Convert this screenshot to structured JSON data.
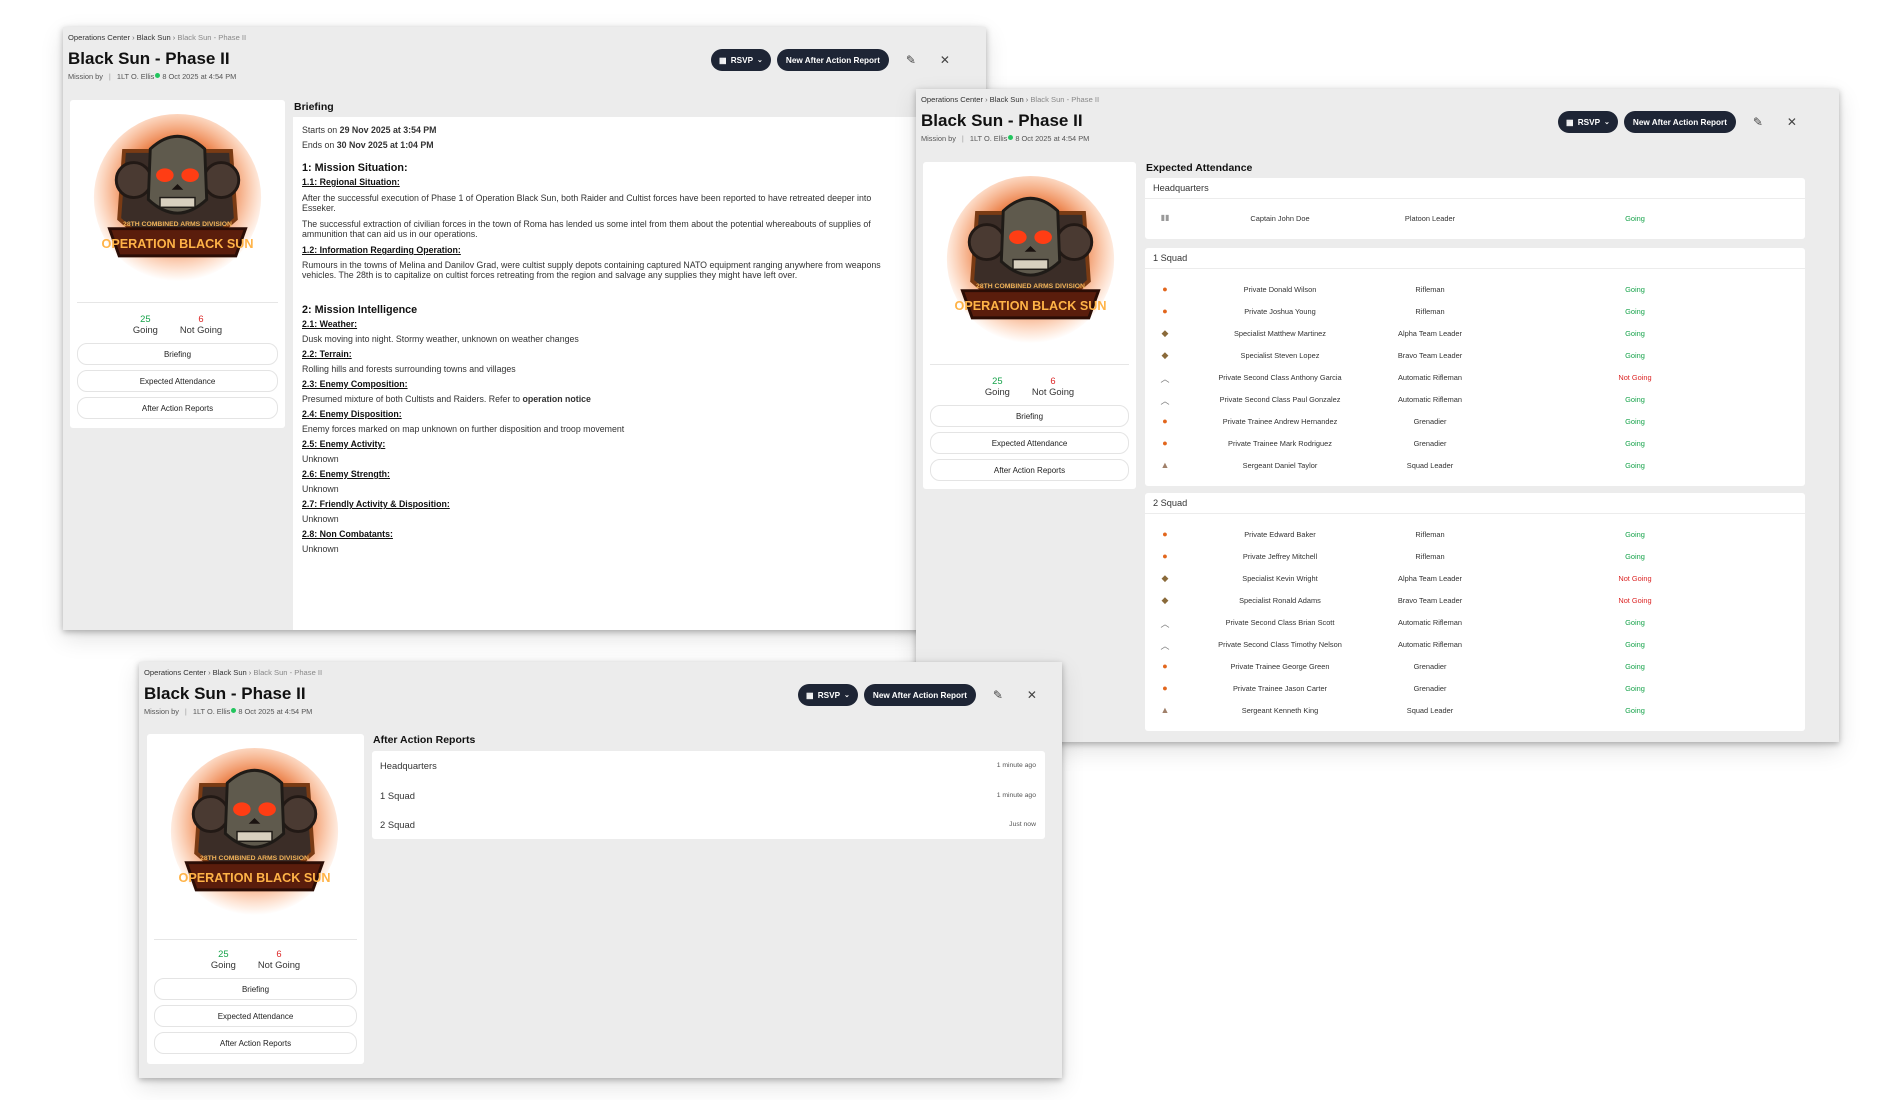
{
  "common": {
    "breadcrumb": [
      "Operations Center",
      "Black Sun",
      "Black Sun - Phase II"
    ],
    "title": "Black Sun - Phase II",
    "mission_by_label": "Mission by",
    "author": "1LT O. Ellis",
    "created": "8 Oct 2025 at 4:54 PM",
    "rsvp_label": "RSVP",
    "new_aar_label": "New After Action Report",
    "logo_top_text": "28TH COMBINED ARMS DIVISION",
    "logo_banner_text": "OPERATION BLACK SUN",
    "going_count": "25",
    "going_label": "Going",
    "not_going_count": "6",
    "not_going_label": "Not Going",
    "nav": [
      "Briefing",
      "Expected Attendance",
      "After Action Reports"
    ]
  },
  "briefing": {
    "section_title": "Briefing",
    "starts_prefix": "Starts on",
    "starts_value": "29 Nov 2025 at 3:54 PM",
    "ends_prefix": "Ends on",
    "ends_value": "30 Nov 2025 at 1:04 PM",
    "h1": "1: Mission Situation:",
    "s11": "1.1: Regional Situation:",
    "p11a_l1": "After the successful execution of Phase 1 of Operation Black Sun, both Raider and Cultist forces have been reported to have retreated deeper into",
    "p11a_l2": "Esseker.",
    "p11b_l1": "The successful extraction of civilian forces in the town of Roma has lended us some intel from them about the potential whereabouts of supplies of",
    "p11b_l2": "ammunition that can aid us in our operations.",
    "s12": "1.2: Information Regarding Operation:",
    "p12_l1": "Rumours in the towns of Melina and Danilov Grad, were cultist supply depots containing captured NATO equipment ranging anywhere from weapons",
    "p12_l2": "vehicles. The 28th is to capitalize on cultist forces retreating from the region and salvage any supplies they might have left over.",
    "h2": "2: Mission Intelligence",
    "s21": "2.1: Weather:",
    "p21": "Dusk moving into night. Stormy weather, unknown on weather changes",
    "s22": "2.2: Terrain:",
    "p22": "Rolling hills and forests surrounding towns and villages",
    "s23": "2.3: Enemy Composition:",
    "p23_prefix": "Presumed mixture of both Cultists and Raiders. Refer to",
    "p23_link": "operation notice",
    "s24": "2.4: Enemy Disposition:",
    "p24": "Enemy forces marked on map unknown on further disposition and troop movement",
    "s25": "2.5: Enemy Activity:",
    "p25": "Unknown",
    "s26": "2.6: Enemy Strength:",
    "p26": "Unknown",
    "s27": "2.7: Friendly Activity & Disposition:",
    "p27": "Unknown",
    "s28": "2.8: Non Combatants:",
    "p28": "Unknown"
  },
  "attendance": {
    "section_title": "Expected Attendance",
    "groups": [
      {
        "name": "Headquarters",
        "rows": [
          {
            "name": "Captain John Doe",
            "role": "Platoon Leader",
            "status": "Going",
            "rank_icon": "captain-bars"
          }
        ]
      },
      {
        "name": "1 Squad",
        "rows": [
          {
            "name": "Private Donald Wilson",
            "role": "Rifleman",
            "status": "Going",
            "rank_icon": "private"
          },
          {
            "name": "Private Joshua Young",
            "role": "Rifleman",
            "status": "Going",
            "rank_icon": "private"
          },
          {
            "name": "Specialist Matthew Martinez",
            "role": "Alpha Team Leader",
            "status": "Going",
            "rank_icon": "specialist"
          },
          {
            "name": "Specialist Steven Lopez",
            "role": "Bravo Team Leader",
            "status": "Going",
            "rank_icon": "specialist"
          },
          {
            "name": "Private Second Class Anthony Garcia",
            "role": "Automatic Rifleman",
            "status": "Not Going",
            "rank_icon": "chevron"
          },
          {
            "name": "Private Second Class Paul Gonzalez",
            "role": "Automatic Rifleman",
            "status": "Going",
            "rank_icon": "chevron"
          },
          {
            "name": "Private Trainee Andrew Hernandez",
            "role": "Grenadier",
            "status": "Going",
            "rank_icon": "private"
          },
          {
            "name": "Private Trainee Mark Rodriguez",
            "role": "Grenadier",
            "status": "Going",
            "rank_icon": "private"
          },
          {
            "name": "Sergeant Daniel Taylor",
            "role": "Squad Leader",
            "status": "Going",
            "rank_icon": "sergeant"
          }
        ]
      },
      {
        "name": "2 Squad",
        "rows": [
          {
            "name": "Private Edward Baker",
            "role": "Rifleman",
            "status": "Going",
            "rank_icon": "private"
          },
          {
            "name": "Private Jeffrey Mitchell",
            "role": "Rifleman",
            "status": "Going",
            "rank_icon": "private"
          },
          {
            "name": "Specialist Kevin Wright",
            "role": "Alpha Team Leader",
            "status": "Not Going",
            "rank_icon": "specialist"
          },
          {
            "name": "Specialist Ronald Adams",
            "role": "Bravo Team Leader",
            "status": "Not Going",
            "rank_icon": "specialist"
          },
          {
            "name": "Private Second Class Brian Scott",
            "role": "Automatic Rifleman",
            "status": "Going",
            "rank_icon": "chevron"
          },
          {
            "name": "Private Second Class Timothy Nelson",
            "role": "Automatic Rifleman",
            "status": "Going",
            "rank_icon": "chevron"
          },
          {
            "name": "Private Trainee George Green",
            "role": "Grenadier",
            "status": "Going",
            "rank_icon": "private"
          },
          {
            "name": "Private Trainee Jason Carter",
            "role": "Grenadier",
            "status": "Going",
            "rank_icon": "private"
          },
          {
            "name": "Sergeant Kenneth King",
            "role": "Squad Leader",
            "status": "Going",
            "rank_icon": "sergeant"
          }
        ]
      }
    ]
  },
  "aar": {
    "section_title": "After Action Reports",
    "reports": [
      {
        "label": "Headquarters",
        "time": "1 minute ago"
      },
      {
        "label": "1 Squad",
        "time": "1 minute ago"
      },
      {
        "label": "2 Squad",
        "time": "Just now"
      }
    ]
  }
}
